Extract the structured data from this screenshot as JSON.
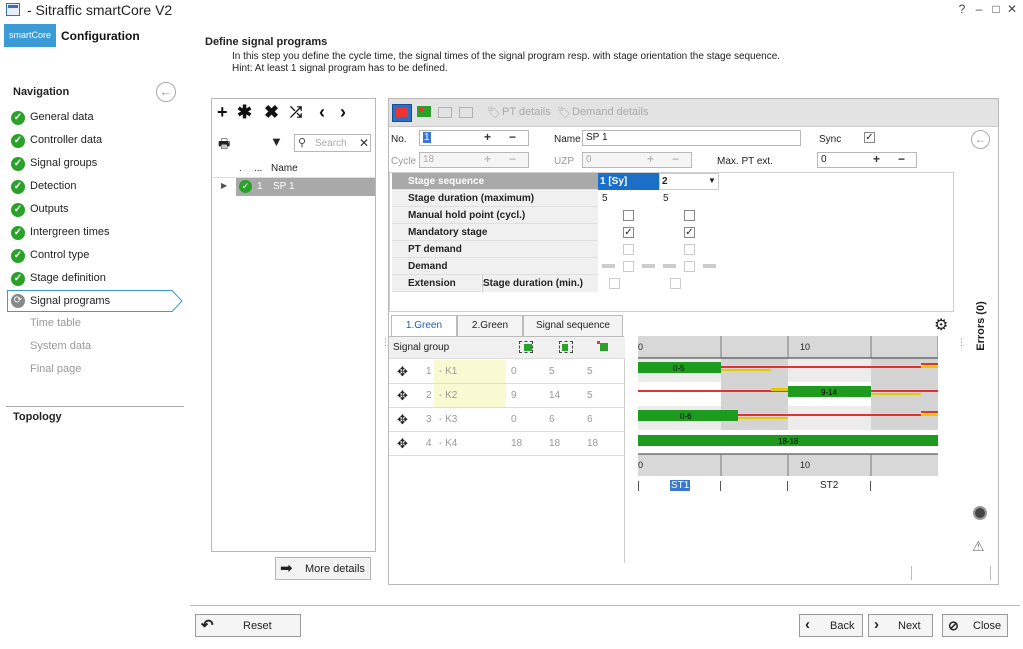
{
  "window": {
    "title": "- Sitraffic smartCore V2",
    "help": "?",
    "minimize": "–",
    "maximize": "□",
    "close": "✕"
  },
  "brand": {
    "badge": "smartCore",
    "title": "Configuration"
  },
  "nav": {
    "heading": "Navigation",
    "items": [
      {
        "label": "General data",
        "state": "done"
      },
      {
        "label": "Controller data",
        "state": "done"
      },
      {
        "label": "Signal groups",
        "state": "done"
      },
      {
        "label": "Detection",
        "state": "done"
      },
      {
        "label": "Outputs",
        "state": "done"
      },
      {
        "label": "Intergreen times",
        "state": "done"
      },
      {
        "label": "Control type",
        "state": "done"
      },
      {
        "label": "Stage definition",
        "state": "done"
      },
      {
        "label": "Signal programs",
        "state": "active"
      },
      {
        "label": "Time table",
        "state": "disabled"
      },
      {
        "label": "System data",
        "state": "disabled"
      },
      {
        "label": "Final page",
        "state": "disabled"
      }
    ],
    "topology": "Topology"
  },
  "page": {
    "title": "Define signal programs",
    "description": "In this step you define the cycle time, the signal times of the signal program resp. with stage orientation the stage sequence.",
    "hint": "Hint: At least 1 signal program has to be defined."
  },
  "list": {
    "search_placeholder": "Search",
    "columns": [
      ".",
      "...",
      "Name"
    ],
    "rows": [
      {
        "num": "1",
        "name": "SP 1"
      }
    ],
    "more_details": "More details"
  },
  "editor": {
    "toolbar": {
      "pt_details": "PT details",
      "demand_details": "Demand details"
    },
    "fields": {
      "no_label": "No.",
      "no_value": "1",
      "name_label": "Name",
      "name_value": "SP 1",
      "sync_label": "Sync",
      "sync_checked": true,
      "cycle_label": "Cycle",
      "cycle_value": "18",
      "uzp_label": "UZP",
      "uzp_value": "0",
      "maxpt_label": "Max. PT ext.",
      "maxpt_value": "0",
      "plus": "+",
      "minus": "−"
    },
    "stage_grid": {
      "rows": [
        "Stage sequence",
        "Stage duration (maximum)",
        "Manual hold point (cycl.)",
        "Mandatory stage",
        "PT demand",
        "Demand",
        "Extension"
      ],
      "extension_sub": "Stage duration (min.)",
      "columns": [
        {
          "header": "1 [Sy]",
          "duration": "5",
          "manual_hold": false,
          "mandatory": true
        },
        {
          "header": "2",
          "duration": "5",
          "manual_hold": false,
          "mandatory": true
        }
      ]
    },
    "tabs": [
      "1.Green",
      "2.Green",
      "Signal sequence"
    ],
    "sg_table": {
      "header": "Signal group",
      "rows": [
        {
          "num": "1",
          "name": "- K1",
          "a": "0",
          "b": "5",
          "c": "5"
        },
        {
          "num": "2",
          "name": "- K2",
          "a": "9",
          "b": "14",
          "c": "5"
        },
        {
          "num": "3",
          "name": "- K3",
          "a": "0",
          "b": "6",
          "c": "6"
        },
        {
          "num": "4",
          "name": "- K4",
          "a": "18",
          "b": "18",
          "c": "18"
        }
      ]
    },
    "timeline": {
      "axis_top": [
        "0",
        "10"
      ],
      "axis_bottom": [
        "0",
        "10"
      ],
      "bars": [
        "0-5",
        "9-14",
        "0-6",
        "18-18"
      ],
      "stages": [
        "ST1",
        "ST2"
      ]
    },
    "errors": "Errors (0)"
  },
  "footer": {
    "reset": "Reset",
    "back": "Back",
    "next": "Next",
    "close": "Close"
  }
}
